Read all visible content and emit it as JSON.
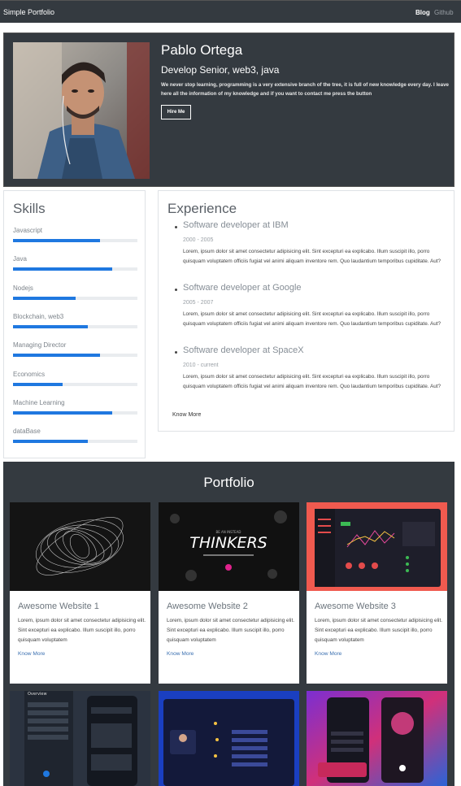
{
  "navbar": {
    "brand": "Simple Portfolio",
    "links": [
      "Blog",
      "Github"
    ]
  },
  "hero": {
    "name": "Pablo Ortega",
    "role": "Develop Senior, web3, java",
    "description": "We never stop learning, programming is a very extensive branch of the tree, it is full of new knowledge every day. I leave here all the information of my knowledge and if you want to contact me press the button",
    "button": "Hire Me"
  },
  "skills": {
    "title": "Skills",
    "items": [
      {
        "name": "Javascript",
        "level": 0.7
      },
      {
        "name": "Java",
        "level": 0.8
      },
      {
        "name": "Nodejs",
        "level": 0.5
      },
      {
        "name": "Blockchain, web3",
        "level": 0.6
      },
      {
        "name": "Managing Director",
        "level": 0.7
      },
      {
        "name": "Economics",
        "level": 0.4
      },
      {
        "name": "Machine Learning",
        "level": 0.8
      },
      {
        "name": "dataBase",
        "level": 0.6
      }
    ]
  },
  "experience": {
    "title": "Experience",
    "items": [
      {
        "title": "Software developer at IBM",
        "dates": "2000 - 2005",
        "text": "Lorem, ipsum dolor sit amet consectetur adipisicing elit. Sint excepturi ea explicabo. Illum suscipit illo, porro quisquam voluptatem officiis fugiat vel animi aliquam inventore rem. Quo laudantium temporibus cupiditate. Aut?"
      },
      {
        "title": "Software developer at Google",
        "dates": "2005 - 2007",
        "text": "Lorem, ipsum dolor sit amet consectetur adipisicing elit. Sint excepturi ea explicabo. Illum suscipit illo, porro quisquam voluptatem officiis fugiat vel animi aliquam inventore rem. Quo laudantium temporibus cupiditate. Aut?"
      },
      {
        "title": "Software developer at SpaceX",
        "dates": "2010 - current",
        "text": "Lorem, ipsum dolor sit amet consectetur adipisicing elit. Sint excepturi ea explicabo. Illum suscipit illo, porro quisquam voluptatem officiis fugiat vel animi aliquam inventore rem. Quo laudantium temporibus cupiditate. Aut?"
      }
    ],
    "know_more": "Know More"
  },
  "portfolio": {
    "title": "Portfolio",
    "cards": [
      {
        "title": "Awesome Website 1",
        "text": "Lorem, ipsum dolor sit amet consectetur adipisicing elit. Sint excepturi ea explicabo. Illum suscipit illo, porro quisquam voluptatem",
        "link": "Know More"
      },
      {
        "title": "Awesome Website 2",
        "text": "Lorem, ipsum dolor sit amet consectetur adipisicing elit. Sint excepturi ea explicabo. Illum suscipit illo, porro quisquam voluptatem",
        "link": "Know More"
      },
      {
        "title": "Awesome Website 3",
        "text": "Lorem, ipsum dolor sit amet consectetur adipisicing elit. Sint excepturi ea explicabo. Illum suscipit illo, porro quisquam voluptatem",
        "link": "Know More"
      }
    ],
    "thumb2_caption": "THINKERS",
    "thumb2_top": "BE AN INSTEAD",
    "thumb6_heading": "Overview"
  }
}
